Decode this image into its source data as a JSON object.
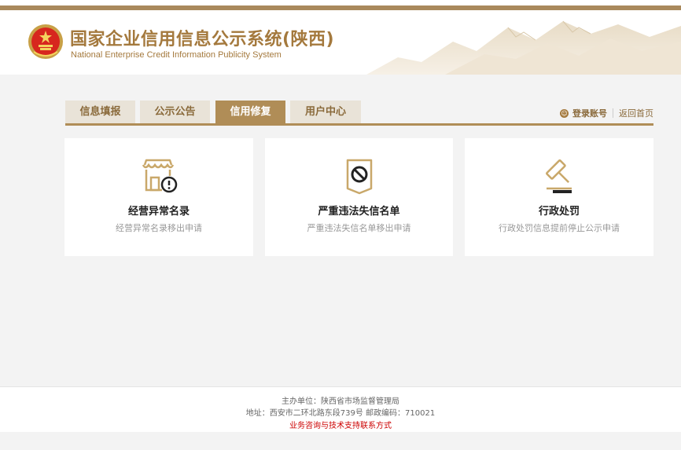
{
  "header": {
    "title_cn": "国家企业信用信息公示系统(陕西)",
    "title_en": "National Enterprise Credit Information Publicity System",
    "emblem_icon": "national-emblem-icon"
  },
  "nav": {
    "tabs": [
      {
        "label": "信息填报",
        "active": false
      },
      {
        "label": "公示公告",
        "active": false
      },
      {
        "label": "信用修复",
        "active": true
      },
      {
        "label": "用户中心",
        "active": false
      }
    ]
  },
  "account": {
    "login_label": "登录账号",
    "home_label": "返回首页",
    "icon": "user-icon"
  },
  "cards": [
    {
      "title": "经营异常名录",
      "desc": "经营异常名录移出申请",
      "icon": "shop-alert-icon"
    },
    {
      "title": "严重违法失信名单",
      "desc": "严重违法失信名单移出申请",
      "icon": "prohibited-list-icon"
    },
    {
      "title": "行政处罚",
      "desc": "行政处罚信息提前停止公示申请",
      "icon": "gavel-icon"
    }
  ],
  "footer": {
    "sponsor": "主办单位：陕西省市场监督管理局",
    "address": "地址：西安市二环北路东段739号    邮政编码：710021",
    "contact_link": "业务咨询与技术支持联系方式"
  },
  "colors": {
    "accent": "#b08d57",
    "title": "#a4793d",
    "tab_inactive": "#e9e3d8",
    "link_red": "#cc0000"
  }
}
